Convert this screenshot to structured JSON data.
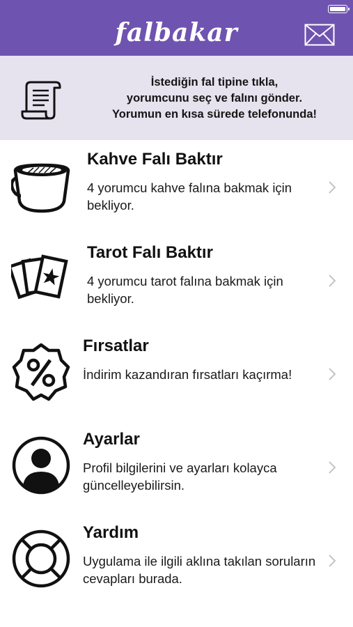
{
  "app": {
    "title": "falbakar"
  },
  "colors": {
    "header": "#6f53b0",
    "banner": "#e6e2ee"
  },
  "icons": {
    "mail": "mail-icon",
    "scroll": "scroll-icon",
    "chevron": "chevron-right-icon"
  },
  "banner": {
    "line1": "İstediğin fal tipine tıkla,",
    "line2": "yorumcunu seç ve falını gönder.",
    "line3": "Yorumun en kısa sürede telefonunda!"
  },
  "menu": {
    "coffee": {
      "title": "Kahve Falı Baktır",
      "desc": "4 yorumcu kahve falına bakmak için bekliyor.",
      "icon": "coffee-cup-icon"
    },
    "tarot": {
      "title": "Tarot Falı Baktır",
      "desc": "4 yorumcu tarot falına bakmak için bekliyor.",
      "icon": "tarot-cards-icon"
    },
    "deals": {
      "title": "Fırsatlar",
      "desc": "İndirim kazandıran fırsatları kaçırma!",
      "icon": "discount-badge-icon"
    },
    "settings": {
      "title": "Ayarlar",
      "desc": "Profil bilgilerini ve ayarları kolayca güncelleyebilirsin.",
      "icon": "user-profile-icon"
    },
    "help": {
      "title": "Yardım",
      "desc": "Uygulama ile ilgili aklına takılan soruların cevapları burada.",
      "icon": "lifebuoy-icon"
    }
  }
}
